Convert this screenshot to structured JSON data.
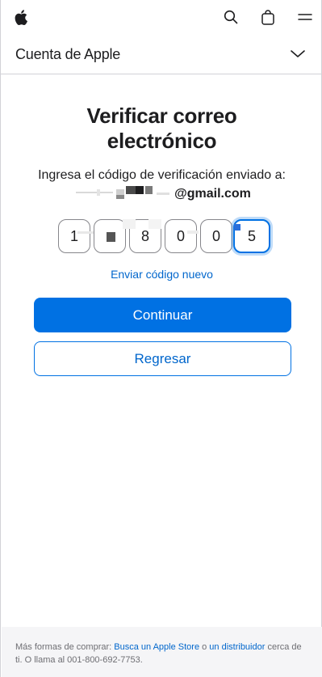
{
  "globalnav": {
    "icons": [
      "apple-logo",
      "search-icon",
      "bag-icon",
      "menu-icon"
    ]
  },
  "localnav": {
    "title": "Cuenta de Apple",
    "chevron_icon": "chevron-down-icon"
  },
  "main": {
    "title_line1": "Verificar correo",
    "title_line2": "electrónico",
    "instruction": "Ingresa el código de verificación enviado a:",
    "email_suffix": "@gmail.com",
    "code_digits": [
      "1",
      "",
      "8",
      "0",
      "0",
      "5"
    ],
    "resend_label": "Enviar código nuevo",
    "continue_label": "Continuar",
    "back_label": "Regresar"
  },
  "footer": {
    "text_before": "Más formas de comprar: ",
    "link1": "Busca un Apple Store",
    "text_mid": " o ",
    "link2": "un distribuidor",
    "text_after": " cerca de ti. O llama al 001-800-692-7753."
  },
  "colors": {
    "accent": "#0071e3",
    "link": "#0066cc",
    "text": "#1d1d1f",
    "footer_bg": "#f5f5f7"
  }
}
